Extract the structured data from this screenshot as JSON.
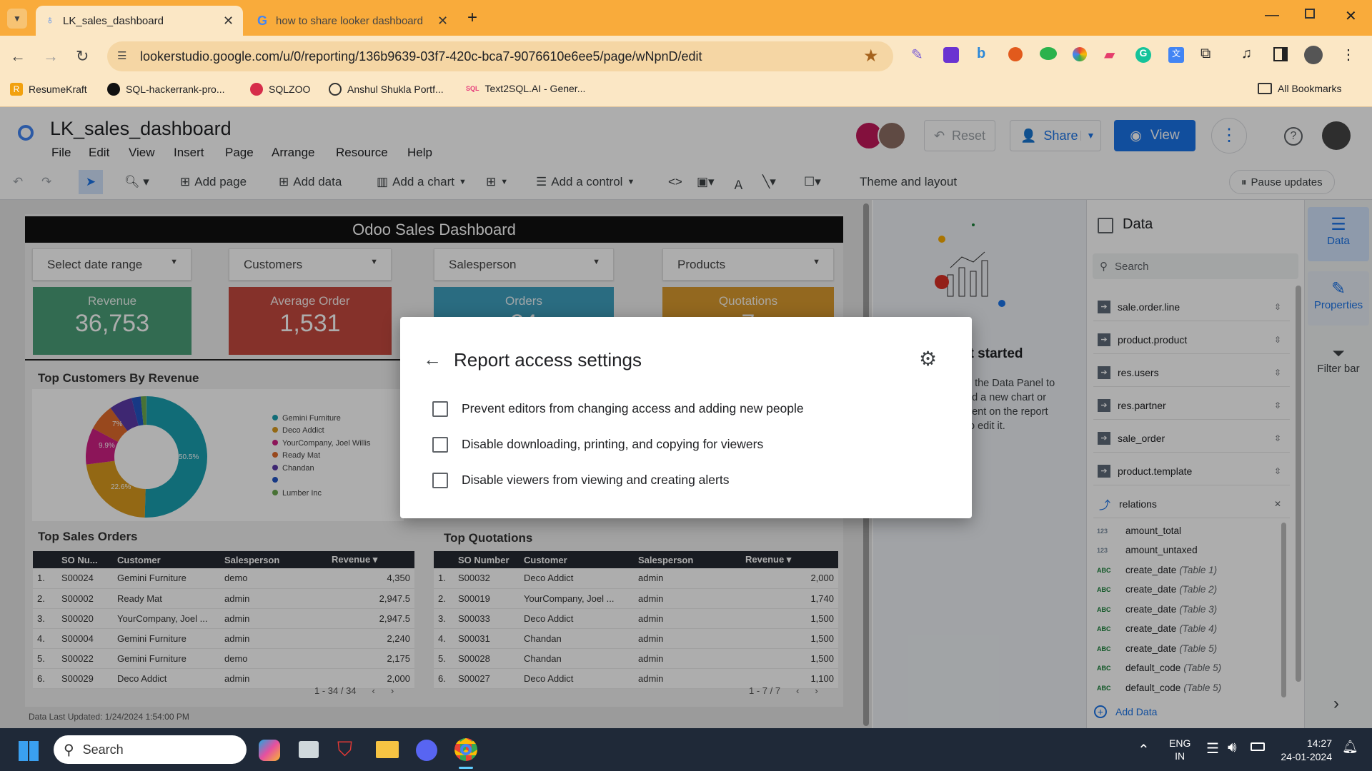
{
  "browser": {
    "tabs": [
      {
        "title": "LK_sales_dashboard"
      },
      {
        "title": "how to share looker dashboard"
      }
    ],
    "url": "lookerstudio.google.com/u/0/reporting/136b9639-03f7-420c-bca7-9076610e6ee5/page/wNpnD/edit",
    "bookmarks": [
      "ResumeKraft",
      "SQL-hackerrank-pro...",
      "SQLZOO",
      "Anshul Shukla Portf...",
      "Text2SQL.AI - Gener..."
    ],
    "all_bookmarks": "All Bookmarks"
  },
  "app": {
    "report_title": "LK_sales_dashboard",
    "menu": [
      "File",
      "Edit",
      "View",
      "Insert",
      "Page",
      "Arrange",
      "Resource",
      "Help"
    ],
    "reset": "Reset",
    "share": "Share",
    "view": "View",
    "toolbar": {
      "add_page": "Add page",
      "add_data": "Add data",
      "add_chart": "Add a chart",
      "add_control": "Add a control",
      "theme": "Theme and layout",
      "pause": "Pause updates"
    }
  },
  "report": {
    "title": "Odoo Sales Dashboard",
    "filters": [
      "Select date range",
      "Customers",
      "Salesperson",
      "Products"
    ],
    "kpis": [
      {
        "label": "Revenue",
        "value": "36,753",
        "color": "#4a9e78"
      },
      {
        "label": "Average Order",
        "value": "1,531",
        "color": "#c5493f"
      },
      {
        "label": "Orders",
        "value": "24",
        "color": "#3f9fbf"
      },
      {
        "label": "Quotations",
        "value": "7",
        "color": "#d99a2e"
      }
    ],
    "pie": {
      "title": "Top Customers By Revenue",
      "legend": [
        "Gemini Furniture",
        "Deco Addict",
        "YourCompany, Joel Willis",
        "Ready Mat",
        "Chandan",
        "",
        "Lumber Inc"
      ],
      "labels": {
        "a": "50.5%",
        "b": "22.6%",
        "c": "9.9%",
        "d": "7%"
      }
    },
    "sales_orders": {
      "title": "Top Sales Orders",
      "headers": [
        "SO Nu...",
        "Customer",
        "Salesperson",
        "Revenue ▾"
      ],
      "rows": [
        [
          "1.",
          "S00024",
          "Gemini Furniture",
          "demo",
          "4,350"
        ],
        [
          "2.",
          "S00002",
          "Ready Mat",
          "admin",
          "2,947.5"
        ],
        [
          "3.",
          "S00020",
          "YourCompany, Joel ...",
          "admin",
          "2,947.5"
        ],
        [
          "4.",
          "S00004",
          "Gemini Furniture",
          "admin",
          "2,240"
        ],
        [
          "5.",
          "S00022",
          "Gemini Furniture",
          "demo",
          "2,175"
        ],
        [
          "6.",
          "S00029",
          "Deco Addict",
          "admin",
          "2,000"
        ]
      ],
      "pager": "1 - 34 / 34"
    },
    "quotations": {
      "title": "Top Quotations",
      "headers": [
        "SO Number",
        "Customer",
        "Salesperson",
        "Revenue ▾"
      ],
      "rows": [
        [
          "1.",
          "S00032",
          "Deco Addict",
          "admin",
          "2,000"
        ],
        [
          "2.",
          "S00019",
          "YourCompany, Joel ...",
          "admin",
          "1,740"
        ],
        [
          "3.",
          "S00033",
          "Deco Addict",
          "admin",
          "1,500"
        ],
        [
          "4.",
          "S00031",
          "Chandan",
          "admin",
          "1,500"
        ],
        [
          "5.",
          "S00028",
          "Chandan",
          "admin",
          "1,500"
        ],
        [
          "6.",
          "S00027",
          "Deco Addict",
          "admin",
          "1,100"
        ]
      ],
      "pager": "1 - 7 / 7"
    },
    "updated": "Data Last Updated: 1/24/2024 1:54:00 PM"
  },
  "get_started": {
    "heading": "et started",
    "text": [
      "n the Data Panel to",
      "dd a new chart or",
      "nent on the report",
      "to edit it."
    ]
  },
  "data_panel": {
    "title": "Data",
    "search_placeholder": "Search",
    "sources": [
      "sale.order.line",
      "product.product",
      "res.users",
      "res.partner",
      "sale_order",
      "product.template",
      "relations"
    ],
    "fields": [
      {
        "type": "123",
        "name": "amount_total",
        "table": ""
      },
      {
        "type": "123",
        "name": "amount_untaxed",
        "table": ""
      },
      {
        "type": "ABC",
        "name": "create_date",
        "table": "(Table 1)"
      },
      {
        "type": "ABC",
        "name": "create_date",
        "table": "(Table 2)"
      },
      {
        "type": "ABC",
        "name": "create_date",
        "table": "(Table 3)"
      },
      {
        "type": "ABC",
        "name": "create_date",
        "table": "(Table 4)"
      },
      {
        "type": "ABC",
        "name": "create_date",
        "table": "(Table 5)"
      },
      {
        "type": "ABC",
        "name": "default_code",
        "table": "(Table 5)"
      },
      {
        "type": "ABC",
        "name": "default_code",
        "table": "(Table 5)"
      }
    ],
    "add_data": "Add Data"
  },
  "rail": {
    "data": "Data",
    "properties": "Properties",
    "filter_bar": "Filter bar"
  },
  "dialog": {
    "title": "Report access settings",
    "options": [
      "Prevent editors from changing access and adding new people",
      "Disable downloading, printing, and copying for viewers",
      "Disable viewers from viewing and creating alerts"
    ]
  },
  "taskbar": {
    "search": "Search",
    "lang1": "ENG",
    "lang2": "IN",
    "time": "14:27",
    "date": "24-01-2024"
  }
}
